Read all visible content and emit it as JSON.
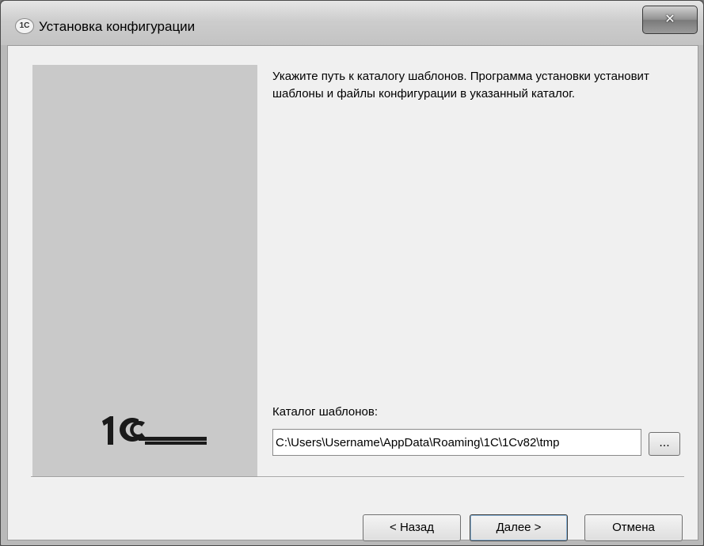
{
  "window": {
    "title": "Установка конфигурации",
    "app_icon_text": "1С",
    "close_glyph": "✕"
  },
  "content": {
    "instruction": "Укажите путь к каталогу шаблонов. Программа установки установит шаблоны и файлы конфигурации в указанный каталог.",
    "path_label": "Каталог шаблонов:",
    "path_value": "C:\\Users\\Username\\AppData\\Roaming\\1C\\1Cv82\\tmp",
    "browse_label": "..."
  },
  "buttons": {
    "back": "< Назад",
    "next": "Далее >",
    "cancel": "Отмена"
  },
  "icons": {
    "logo": "1c-logo-icon",
    "app": "1c-app-icon",
    "close": "close-icon"
  }
}
